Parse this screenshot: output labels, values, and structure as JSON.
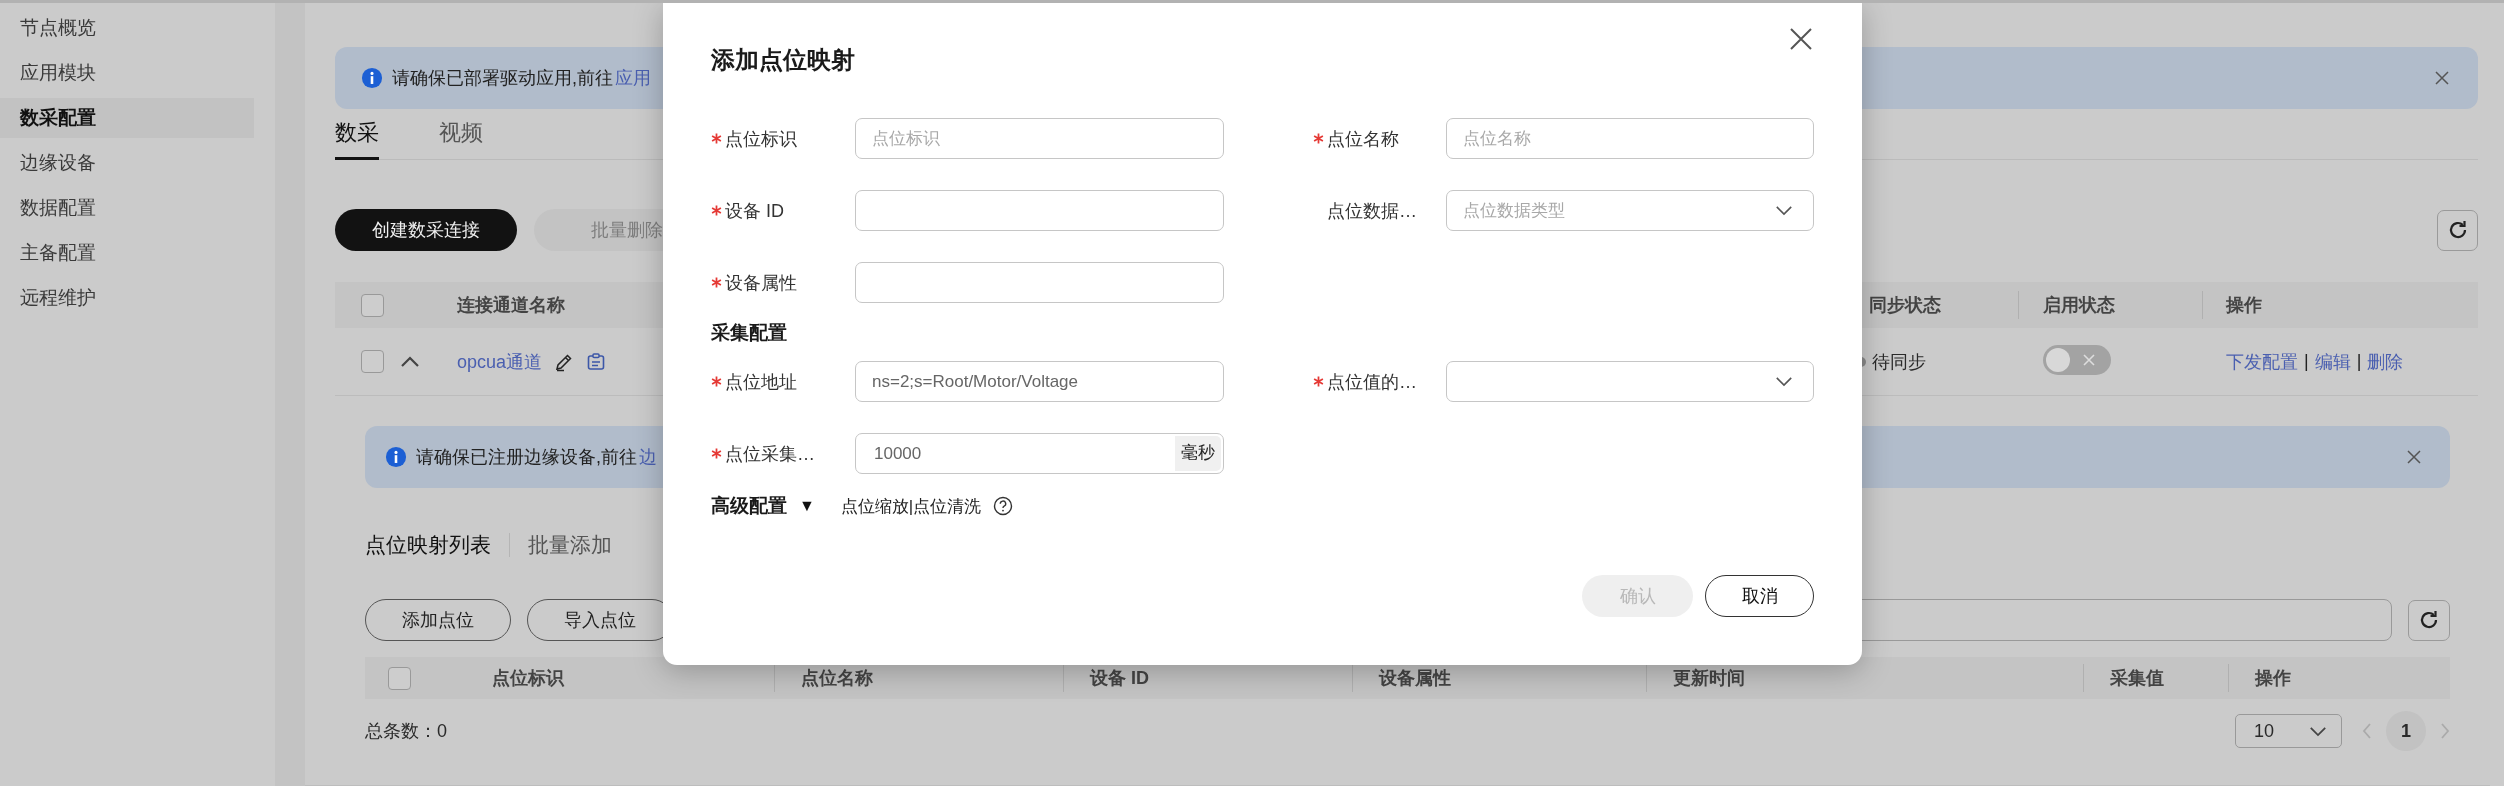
{
  "sidebar": {
    "items": [
      {
        "label": "节点概览",
        "selected": false
      },
      {
        "label": "应用模块",
        "selected": false
      },
      {
        "label": "数采配置",
        "selected": true
      },
      {
        "label": "边缘设备",
        "selected": false
      },
      {
        "label": "数据配置",
        "selected": false
      },
      {
        "label": "主备配置",
        "selected": false
      },
      {
        "label": "远程维护",
        "selected": false
      }
    ]
  },
  "notice": {
    "text": "请确保已部署驱动应用,前往",
    "link": "应用"
  },
  "tabs": [
    {
      "label": "数采",
      "selected": true
    },
    {
      "label": "视频",
      "selected": false
    }
  ],
  "toolbar": {
    "buttons": [
      {
        "label": "创建数采连接",
        "disabled": false
      },
      {
        "label": "批量删除",
        "disabled": true
      }
    ]
  },
  "connections": {
    "header_checked": false,
    "columns": [
      "连接通道名称",
      "同步状态",
      "启用状态",
      "操作"
    ],
    "action_separator": "|",
    "rows": [
      {
        "checked": false,
        "expanded": true,
        "name": "opcua通道",
        "sync_status": "待同步",
        "enabled": false,
        "actions": [
          "下发配置",
          "编辑",
          "删除"
        ]
      }
    ]
  },
  "points": {
    "notice": {
      "text": "请确保已注册边缘设备,前往",
      "link": "边"
    },
    "tabs": [
      {
        "label": "点位映射列表",
        "selected": true
      },
      {
        "label": "批量添加",
        "selected": false
      }
    ],
    "buttons": [
      "添加点位",
      "导入点位"
    ],
    "header_checked": false,
    "columns": [
      "点位标识",
      "点位名称",
      "设备 ID",
      "设备属性",
      "更新时间",
      "采集值",
      "操作"
    ],
    "total": "总条数：0",
    "page_size": "10",
    "pages": [
      {
        "label": "1",
        "selected": true
      }
    ]
  },
  "dialog": {
    "title": "添加点位映射",
    "groups": [
      {
        "rows": [
          [
            {
              "label": "点位标识",
              "required": true,
              "kind": "input",
              "placeholder": "点位标识"
            },
            {
              "label": "点位名称",
              "required": true,
              "kind": "input",
              "placeholder": "点位名称"
            }
          ],
          [
            {
              "label": "设备 ID",
              "required": true,
              "kind": "input"
            },
            {
              "label": "点位数据…",
              "required": false,
              "kind": "select",
              "placeholder": "点位数据类型"
            }
          ],
          [
            {
              "label": "设备属性",
              "required": true,
              "kind": "input"
            }
          ]
        ]
      },
      {
        "title": "采集配置",
        "rows": [
          [
            {
              "label": "点位地址",
              "required": true,
              "kind": "input",
              "value": "ns=2;s=Root/Motor/Voltage"
            },
            {
              "label": "点位值的…",
              "required": true,
              "kind": "select"
            }
          ],
          [
            {
              "label": "点位采集…",
              "required": true,
              "kind": "unit-input",
              "value": "10000",
              "unit": "毫秒"
            }
          ]
        ]
      }
    ],
    "advanced": {
      "label": "高级配置",
      "toggle": "▼",
      "hint": "点位缩放|点位清洗"
    },
    "buttons": [
      {
        "label": "确认",
        "disabled": true
      },
      {
        "label": "取消",
        "disabled": false
      }
    ]
  }
}
